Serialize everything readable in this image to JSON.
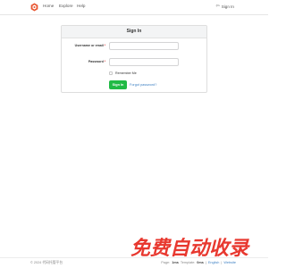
{
  "nav": {
    "home": "Home",
    "explore": "Explore",
    "help": "Help",
    "signin": "Sign In"
  },
  "form": {
    "title": "Sign In",
    "username_label": "Username or email",
    "password_label": "Password",
    "required_mark": "*",
    "remember_label": "Remember Me",
    "submit_label": "Sign In",
    "forgot_label": "Forgot password?"
  },
  "watermark": {
    "text": "免费自动收录"
  },
  "footer": {
    "copyright": "© 2024 代码托管平台",
    "page_label": "Page:",
    "page_time": "1ms",
    "template_label": "Template:",
    "template_time": "0ms",
    "language": "English",
    "separator": "|",
    "website": "Website"
  },
  "colors": {
    "accent_green": "#21ba45",
    "link_blue": "#4183c4",
    "logo_orange": "#e8542f",
    "watermark_red": "#e8382f"
  }
}
